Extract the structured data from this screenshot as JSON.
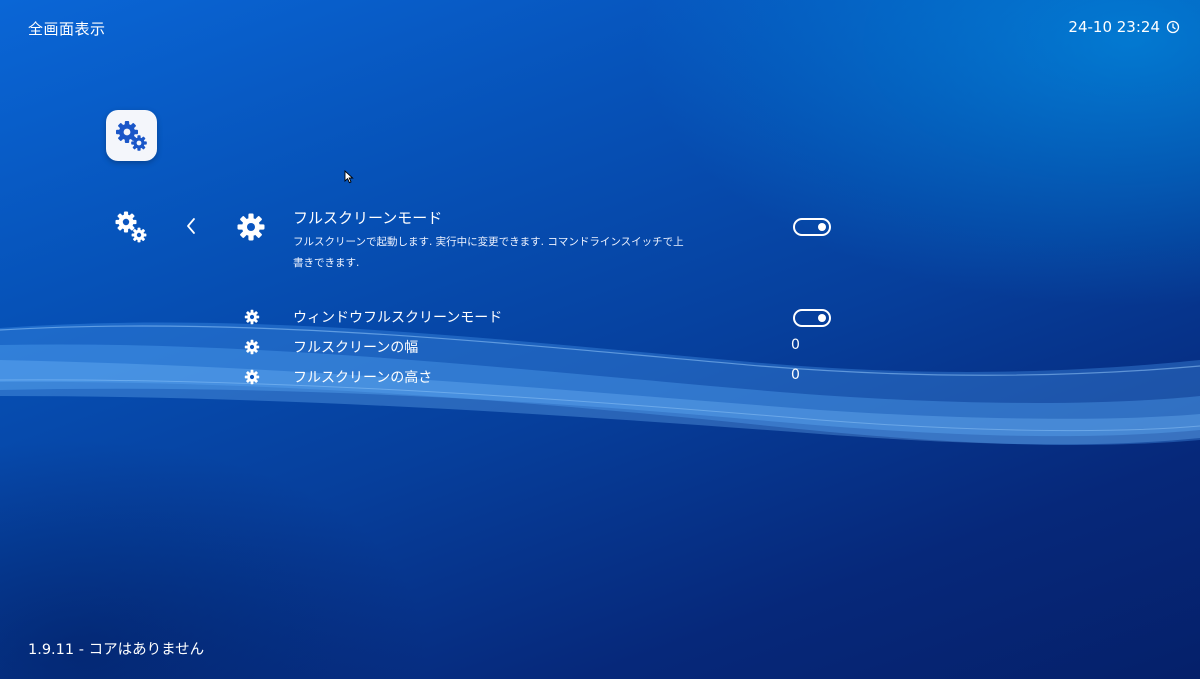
{
  "header": {
    "title": "全画面表示",
    "time": "24-10 23:24",
    "clock_icon": "clock-icon"
  },
  "app_icon": "settings-gears-icon",
  "sidebar": {
    "icon": "settings-gears-icon",
    "back_icon": "chevron-left-icon"
  },
  "settings": {
    "main": {
      "label": "フルスクリーンモード",
      "description": "フルスクリーンで起動します. 実行中に変更できます. コマンドラインスイッチで上書きできます.",
      "icon": "gear-icon",
      "toggle_on": true
    },
    "items": [
      {
        "label": "ウィンドウフルスクリーンモード",
        "icon": "gear-icon",
        "type": "toggle",
        "toggle_on": true
      },
      {
        "label": "フルスクリーンの幅",
        "icon": "gear-icon",
        "type": "value",
        "value": "0"
      },
      {
        "label": "フルスクリーンの高さ",
        "icon": "gear-icon",
        "type": "value",
        "value": "0"
      }
    ]
  },
  "footer": {
    "text": "1.9.11 - コアはありません"
  },
  "colors": {
    "background_top": "#0a66d6",
    "background_bottom": "#05206a",
    "text": "#ffffff",
    "tile": "#f4f6fb",
    "tile_icon": "#1a56c8"
  }
}
